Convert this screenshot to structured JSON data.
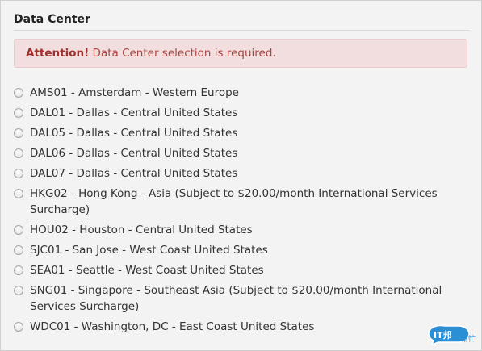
{
  "section": {
    "title": "Data Center"
  },
  "alert": {
    "strong": "Attention!",
    "message": "Data Center selection is required."
  },
  "options": [
    {
      "label": "AMS01 - Amsterdam - Western Europe",
      "selected": false
    },
    {
      "label": "DAL01 - Dallas - Central United States",
      "selected": false
    },
    {
      "label": "DAL05 - Dallas - Central United States",
      "selected": false
    },
    {
      "label": "DAL06 - Dallas - Central United States",
      "selected": false
    },
    {
      "label": "DAL07 - Dallas - Central United States",
      "selected": false
    },
    {
      "label": "HKG02 - Hong Kong - Asia (Subject to $20.00/month International Services Surcharge)",
      "selected": false
    },
    {
      "label": "HOU02 - Houston - Central United States",
      "selected": false
    },
    {
      "label": "SJC01 - San Jose - West Coast United States",
      "selected": false
    },
    {
      "label": "SEA01 - Seattle - West Coast United States",
      "selected": false
    },
    {
      "label": "SNG01 - Singapore - Southeast Asia (Subject to $20.00/month International Services Surcharge)",
      "selected": false
    },
    {
      "label": "WDC01 - Washington, DC - East Coast United States",
      "selected": false
    }
  ],
  "watermark": {
    "text_main": "IT邦",
    "text_sub": "幫忙",
    "icon": "ithelp-logo-icon"
  },
  "colors": {
    "alert_bg": "#f2dede",
    "alert_text": "#a94442",
    "page_bg": "#f3f3f3",
    "watermark_blue": "#2b8fd6"
  }
}
